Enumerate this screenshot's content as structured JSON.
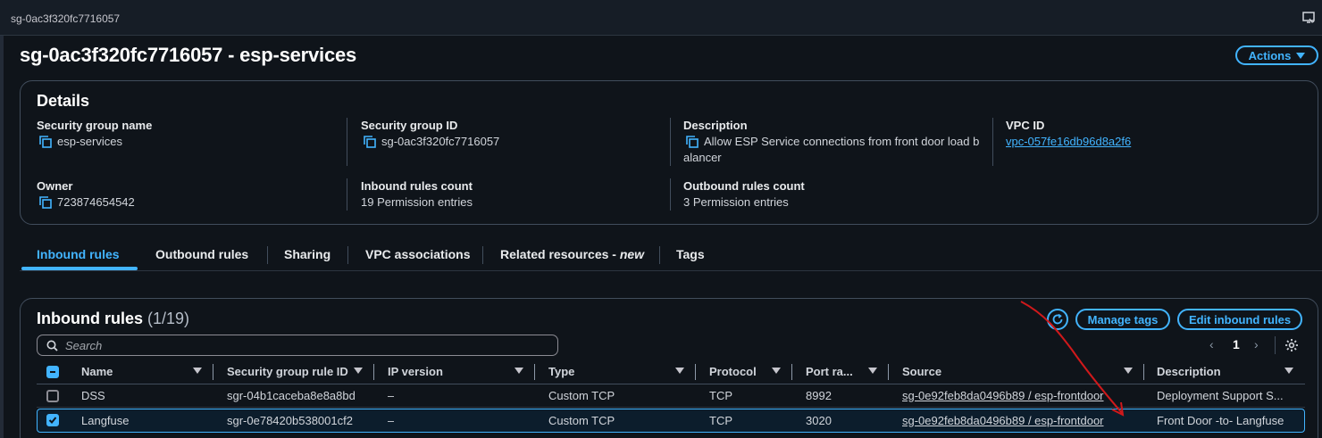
{
  "topbar": {
    "crumb": "sg-0ac3f320fc7716057",
    "corner_icon": "screen-share-icon"
  },
  "page": {
    "title": "sg-0ac3f320fc7716057 - esp-services",
    "actions_label": "Actions"
  },
  "details": {
    "title": "Details",
    "security_group_name": {
      "label": "Security group name",
      "value": "esp-services"
    },
    "security_group_id": {
      "label": "Security group ID",
      "value": "sg-0ac3f320fc7716057"
    },
    "description": {
      "label": "Description",
      "value_line1": "Allow ESP Service connections from front door load b",
      "value_line2": "alancer"
    },
    "vpc_id": {
      "label": "VPC ID",
      "value": "vpc-057fe16db96d8a2f6"
    },
    "owner": {
      "label": "Owner",
      "value": "723874654542"
    },
    "inbound_count": {
      "label": "Inbound rules count",
      "value": "19 Permission entries"
    },
    "outbound_count": {
      "label": "Outbound rules count",
      "value": "3 Permission entries"
    }
  },
  "tabs": [
    {
      "label": "Inbound rules",
      "active": true
    },
    {
      "label": "Outbound rules"
    },
    {
      "label": "Sharing"
    },
    {
      "label": "VPC associations"
    },
    {
      "label": "Related resources - ",
      "suffix": "new"
    },
    {
      "label": "Tags"
    }
  ],
  "inbound": {
    "title": "Inbound rules",
    "count": "(1/19)",
    "manage_tags_label": "Manage tags",
    "edit_label": "Edit inbound rules",
    "search_placeholder": "Search",
    "page": "1",
    "prev": "‹",
    "next": "›",
    "columns": [
      "Name",
      "Security group rule ID",
      "IP version",
      "Type",
      "Protocol",
      "Port ra...",
      "Source",
      "Description"
    ],
    "rows": [
      {
        "name": "DSS",
        "rule_id": "sgr-04b1caceba8e8a8bd",
        "ip_version": "–",
        "type": "Custom TCP",
        "protocol": "TCP",
        "port": "8992",
        "source": "sg-0e92feb8da0496b89 / esp-frontdoor",
        "description": "Deployment Support S...",
        "selected": false
      },
      {
        "name": "Langfuse",
        "rule_id": "sgr-0e78420b538001cf2",
        "ip_version": "–",
        "type": "Custom TCP",
        "protocol": "TCP",
        "port": "3020",
        "source": "sg-0e92feb8da0496b89 / esp-frontdoor",
        "description": "Front Door -to- Langfuse",
        "selected": true
      }
    ]
  },
  "colors": {
    "accent": "#42b4ff",
    "annotation": "#d0191b",
    "background": "#0f141a"
  }
}
